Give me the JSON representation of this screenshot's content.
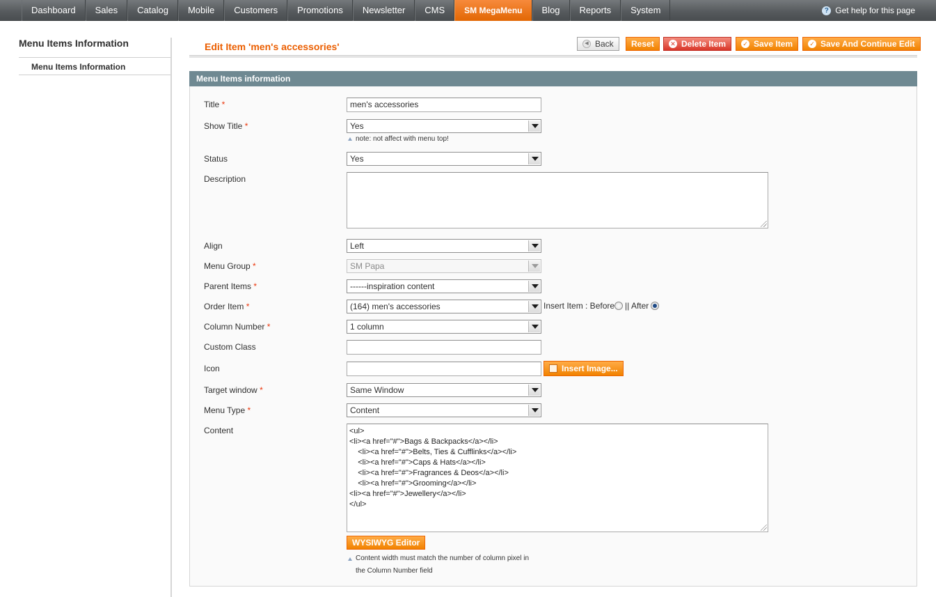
{
  "nav": {
    "items": [
      "Dashboard",
      "Sales",
      "Catalog",
      "Mobile",
      "Customers",
      "Promotions",
      "Newsletter",
      "CMS",
      "SM MegaMenu",
      "Blog",
      "Reports",
      "System"
    ],
    "active_index": 8,
    "help_text": "Get help for this page"
  },
  "sidebar": {
    "title": "Menu Items Information",
    "tab_label": "Menu Items Information"
  },
  "header": {
    "title": "Edit Item 'men's accessories'",
    "buttons": {
      "back": "Back",
      "reset": "Reset",
      "delete": "Delete Item",
      "save": "Save Item",
      "save_continue": "Save And Continue Edit"
    }
  },
  "section": {
    "title": "Menu Items information"
  },
  "form": {
    "title": {
      "label": "Title",
      "value": "men's accessories",
      "required": "*"
    },
    "show_title": {
      "label": "Show Title",
      "value": "Yes",
      "required": "*",
      "note": "note: not affect with menu top!"
    },
    "status": {
      "label": "Status",
      "value": "Yes"
    },
    "description": {
      "label": "Description",
      "value": ""
    },
    "align": {
      "label": "Align",
      "value": "Left"
    },
    "menu_group": {
      "label": "Menu Group",
      "value": "SM Papa",
      "required": "*"
    },
    "parent_items": {
      "label": "Parent Items",
      "value": "------inspiration content",
      "required": "*"
    },
    "order_item": {
      "label": "Order Item",
      "value": "(164) men's accessories",
      "required": "*",
      "insert_label": "Insert Item : Before",
      "after_label": "|| After"
    },
    "column_number": {
      "label": "Column Number",
      "value": "1 column",
      "required": "*"
    },
    "custom_class": {
      "label": "Custom Class",
      "value": ""
    },
    "icon": {
      "label": "Icon",
      "value": "",
      "button": "Insert Image..."
    },
    "target_window": {
      "label": "Target window",
      "value": "Same Window",
      "required": "*"
    },
    "menu_type": {
      "label": "Menu Type",
      "value": "Content",
      "required": "*"
    },
    "content": {
      "label": "Content",
      "lines": [
        "<ul>",
        "<li><a href=\"#\">Bags & Backpacks</a></li>",
        "    <li><a href=\"#\">Belts, Ties & Cufflinks</a></li>",
        "    <li><a href=\"#\">Caps & Hats</a></li>",
        "    <li><a href=\"#\">Fragrances & Deos</a></li>",
        "    <li><a href=\"#\">Grooming</a></li>",
        "<li><a href=\"#\">Jewellery</a></li>",
        "</ul>"
      ],
      "wysiwyg_button": "WYSIWYG Editor",
      "note_line1": "Content width must match the number of column pixel in",
      "note_line2": "the Column Number field"
    }
  }
}
